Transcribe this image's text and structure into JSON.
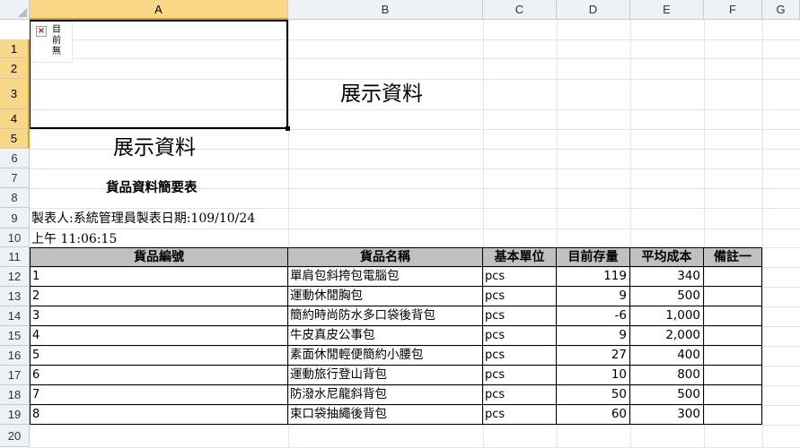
{
  "columns": [
    "A",
    "B",
    "C",
    "D",
    "E",
    "F",
    "G"
  ],
  "rows": [
    "1",
    "2",
    "3",
    "4",
    "5",
    "6",
    "7",
    "8",
    "9",
    "10",
    "11",
    "12",
    "13",
    "14",
    "15",
    "16",
    "17",
    "18",
    "19",
    "20"
  ],
  "image_placeholder": {
    "text": "目前無",
    "icon": "broken-image-icon"
  },
  "display_heading": "展示資料",
  "report_title": "貨品資料簡要表",
  "meta_line1": "製表人:系統管理員製表日期:109/10/24",
  "meta_line2": "上午 11:06:15",
  "table": {
    "headers": [
      "貨品編號",
      "貨品名稱",
      "基本單位",
      "目前存量",
      "平均成本",
      "備註一"
    ],
    "rows": [
      {
        "id": "1",
        "name": "單肩包斜挎包電腦包",
        "unit": "pcs",
        "stock": "119",
        "cost": "340",
        "note": ""
      },
      {
        "id": "2",
        "name": "運動休閒胸包",
        "unit": "pcs",
        "stock": "9",
        "cost": "500",
        "note": ""
      },
      {
        "id": "3",
        "name": "簡約時尚防水多口袋後背包",
        "unit": "pcs",
        "stock": "-6",
        "cost": "1,000",
        "note": ""
      },
      {
        "id": "4",
        "name": "牛皮真皮公事包",
        "unit": "pcs",
        "stock": "9",
        "cost": "2,000",
        "note": ""
      },
      {
        "id": "5",
        "name": "素面休閒輕便簡約小腰包",
        "unit": "pcs",
        "stock": "27",
        "cost": "400",
        "note": ""
      },
      {
        "id": "6",
        "name": "運動旅行登山背包",
        "unit": "pcs",
        "stock": "10",
        "cost": "800",
        "note": ""
      },
      {
        "id": "7",
        "name": "防潑水尼龍斜背包",
        "unit": "pcs",
        "stock": "50",
        "cost": "500",
        "note": ""
      },
      {
        "id": "8",
        "name": "束口袋抽繩後背包",
        "unit": "pcs",
        "stock": "60",
        "cost": "300",
        "note": ""
      }
    ]
  }
}
